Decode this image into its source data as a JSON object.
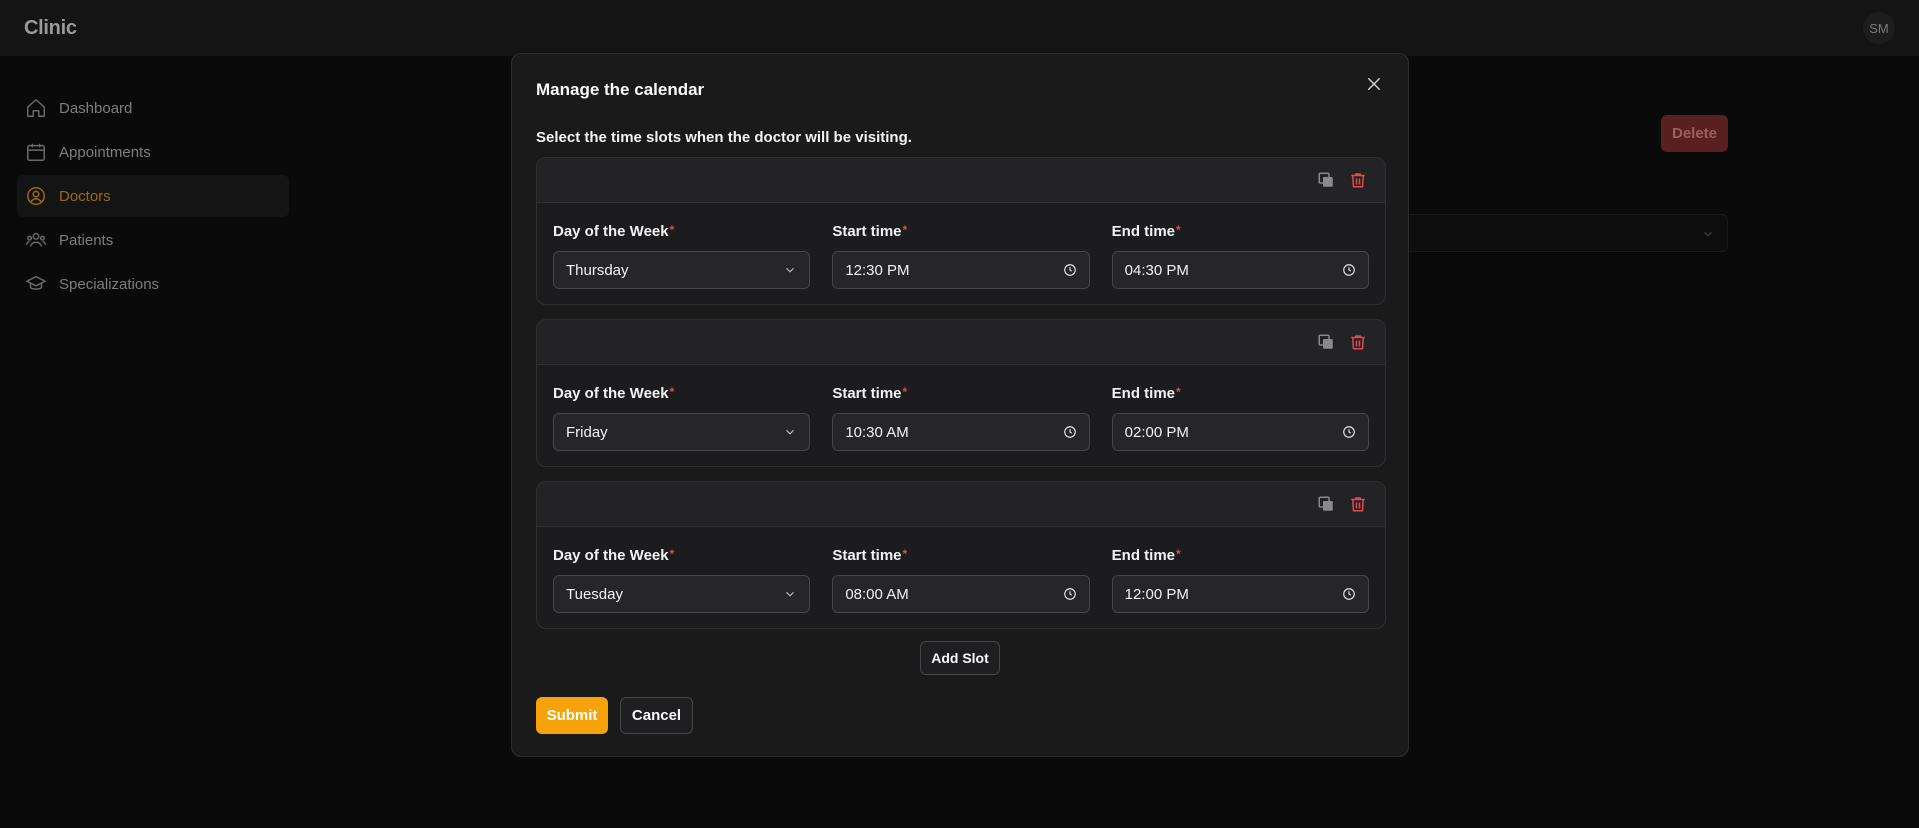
{
  "app": {
    "brand": "Clinic",
    "user_initials": "SM"
  },
  "sidebar": {
    "items": [
      {
        "label": "Dashboard",
        "icon": "home-icon",
        "active": false
      },
      {
        "label": "Appointments",
        "icon": "calendar-icon",
        "active": false
      },
      {
        "label": "Doctors",
        "icon": "user-circle-icon",
        "active": true
      },
      {
        "label": "Patients",
        "icon": "users-icon",
        "active": false
      },
      {
        "label": "Specializations",
        "icon": "graduation-cap-icon",
        "active": false
      }
    ]
  },
  "background": {
    "delete_label": "Delete"
  },
  "modal": {
    "title": "Manage the calendar",
    "description": "Select the time slots when the doctor will be visiting.",
    "labels": {
      "day": "Day of the Week",
      "start": "Start time",
      "end": "End time",
      "required_mark": "*"
    },
    "slots": [
      {
        "day": "Thursday",
        "start": "12:30 PM",
        "end": "04:30 PM"
      },
      {
        "day": "Friday",
        "start": "10:30 AM",
        "end": "02:00 PM"
      },
      {
        "day": "Tuesday",
        "start": "08:00 AM",
        "end": "12:00 PM"
      }
    ],
    "add_slot_label": "Add Slot",
    "submit_label": "Submit",
    "cancel_label": "Cancel"
  },
  "colors": {
    "accent": "#f5a20b",
    "danger": "#e5484d",
    "modal_bg": "#1a1a1b",
    "page_bg": "#0a0a0a"
  }
}
